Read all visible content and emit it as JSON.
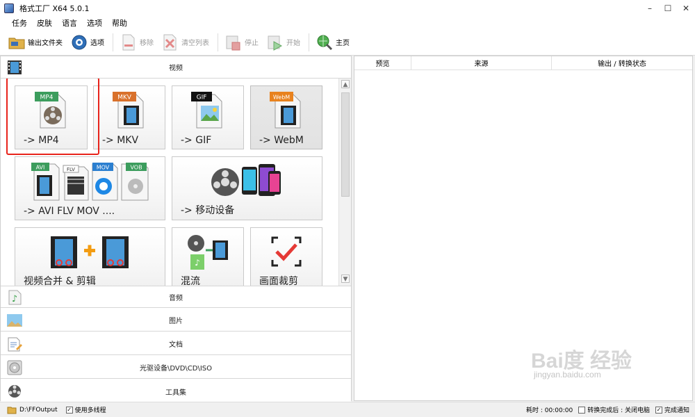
{
  "window": {
    "title": "格式工厂 X64 5.0.1"
  },
  "menu": [
    "任务",
    "皮肤",
    "语言",
    "选项",
    "帮助"
  ],
  "toolbar": {
    "output_folder": "输出文件夹",
    "options": "选项",
    "remove": "移除",
    "clear_list": "清空列表",
    "stop": "停止",
    "start": "开始",
    "home": "主页"
  },
  "categories": {
    "video": "视频",
    "audio": "音频",
    "picture": "图片",
    "document": "文档",
    "disc": "光驱设备\\DVD\\CD\\ISO",
    "tools": "工具集"
  },
  "tiles": {
    "mp4": {
      "label": "-> MP4",
      "tag": "MP4"
    },
    "mkv": {
      "label": "-> MKV",
      "tag": "MKV"
    },
    "gif": {
      "label": "-> GIF",
      "tag": "GIF"
    },
    "webm": {
      "label": "-> WebM",
      "tag": "WebM"
    },
    "multi": {
      "label": "-> AVI FLV MOV ....",
      "tags": [
        "AVI",
        "FLV",
        "MOV",
        "VOB"
      ]
    },
    "mobile": {
      "label": "-> 移动设备"
    },
    "merge": {
      "label": "视频合并 & 剪辑"
    },
    "mux": {
      "label": "混流"
    },
    "crop": {
      "label": "画面裁剪"
    }
  },
  "table": {
    "columns": [
      "预览",
      "来源",
      "输出 / 转换状态"
    ]
  },
  "status": {
    "output_path": "D:\\FFOutput",
    "multithread": "使用多线程",
    "elapsed_label": "耗时 : 00:00:00",
    "after_convert": "转换完成后 : 关闭电脑",
    "notify": "完成通知"
  },
  "watermark": {
    "brand": "Bai度 经验",
    "url": "jingyan.baidu.com"
  }
}
